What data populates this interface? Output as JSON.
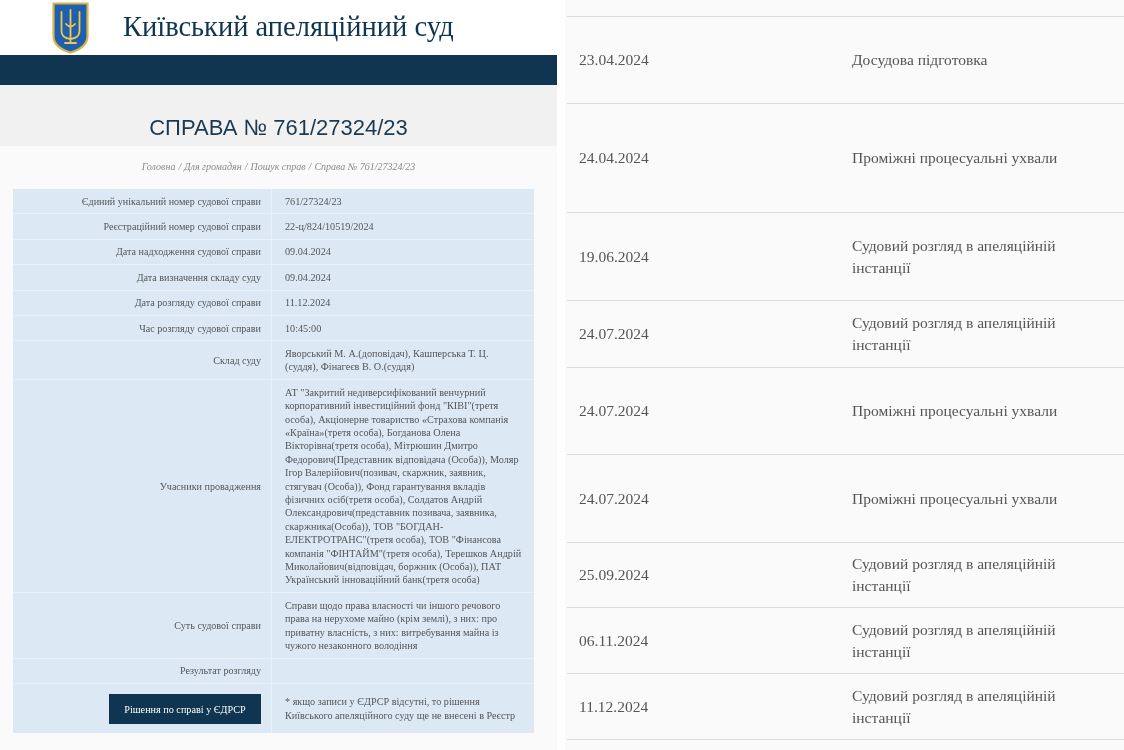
{
  "header": {
    "title": "Київський апеляційний суд"
  },
  "case": {
    "heading": "СПРАВА № 761/27324/23",
    "breadcrumb_separator": "/",
    "breadcrumbs": [
      {
        "label": "Головна"
      },
      {
        "label": "Для громадян"
      },
      {
        "label": "Пошук справ"
      },
      {
        "label": "Справа № 761/27324/23"
      }
    ]
  },
  "details": {
    "rows": [
      {
        "label": "Єдиний унікальний номер судової справи",
        "value": "761/27324/23"
      },
      {
        "label": "Реєстраційний номер судової справи",
        "value": "22-ц/824/10519/2024"
      },
      {
        "label": "Дата надходження судової справи",
        "value": "09.04.2024"
      },
      {
        "label": "Дата визначення складу суду",
        "value": "09.04.2024"
      },
      {
        "label": "Дата розгляду судової справи",
        "value": "11.12.2024"
      },
      {
        "label": "Час розгляду судової справи",
        "value": "10:45:00"
      },
      {
        "label": "Склад суду",
        "value": "Яворський М. А.(доповідач), Кашперська Т. Ц. (суддя), Фінагеєв В. О.(суддя)"
      },
      {
        "label": "Учасники провадження",
        "value": "АТ \"Закритий недиверсифікований венчурний корпоративний інвестиційний фонд \"КІВІ\"(третя особа), Акціонерне товариство «Страхова компанія «Країна»(третя особа), Богданова Олена Вікторівна(третя особа), Мітрюшин Дмитро Федорович(Представник відповідача (Особа)), Моляр Ігор Валерійович(позивач, скаржник, заявник, стягувач (Особа)), Фонд гарантування вкладів фізичних осіб(третя особа), Солдатов Андрій Олександрович(представник позивача, заявника, скаржника(Особа)), ТОВ \"БОГДАН-ЕЛЕКТРОТРАНС\"(третя особа), ТОВ \"Фінансова компанія \"ФІНТАЙМ\"(третя особа), Терешков Андрій Миколайович(відповідач, боржник (Особа)), ПАТ Український інноваційний банк(третя особа)"
      },
      {
        "label": "Суть судової справи",
        "value": "Справи щодо права власності чи іншого речового права на нерухоме майно (крім землі), з них: про приватну власність, з них: витребування майна із чужого незаконного володіння"
      },
      {
        "label": "Результат розгляду"
      }
    ],
    "button": "Рішення по справі у ЄДРСР",
    "note": "* якщо записи у ЄДРСР відсутні, то рішення Київського апеляційного суду ще не внесені в Реєстр"
  },
  "stages": {
    "rows": [
      {
        "date": "23.04.2024",
        "stage": "Досудова підготовка"
      },
      {
        "date": "24.04.2024",
        "stage": "Проміжні процесуальні ухвали"
      },
      {
        "date": "19.06.2024",
        "stage": "Судовий розгляд в апеляційній інстанції"
      },
      {
        "date": "24.07.2024",
        "stage": "Судовий розгляд в апеляційній інстанції"
      },
      {
        "date": "24.07.2024",
        "stage": "Проміжні процесуальні ухвали"
      },
      {
        "date": "24.07.2024",
        "stage": "Проміжні процесуальні ухвали"
      },
      {
        "date": "25.09.2024",
        "stage": "Судовий розгляд в апеляційній інстанції"
      },
      {
        "date": "06.11.2024",
        "stage": "Судовий розгляд в апеляційній інстанції"
      },
      {
        "date": "11.12.2024",
        "stage": "Судовий розгляд в апеляційній інстанції"
      }
    ]
  }
}
